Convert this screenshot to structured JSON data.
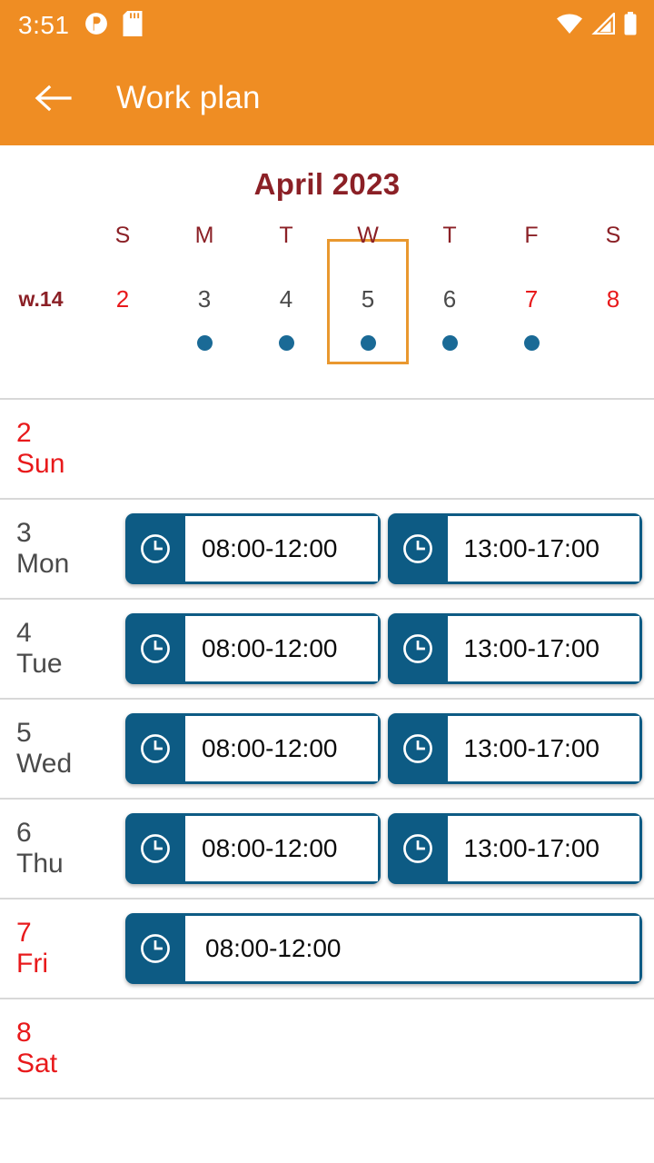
{
  "status_bar": {
    "time": "3:51",
    "icons": [
      "p-badge-icon",
      "sd-card-icon",
      "wifi-icon",
      "cellular-signal-icon",
      "battery-icon"
    ]
  },
  "app_bar": {
    "back_label": "back-arrow-icon",
    "title": "Work plan"
  },
  "calendar": {
    "month_title": "April 2023",
    "week_label": "w.14",
    "weekday_letters": [
      "S",
      "M",
      "T",
      "W",
      "T",
      "F",
      "S"
    ],
    "days": [
      {
        "date": "2",
        "weekend": true,
        "dot": false
      },
      {
        "date": "3",
        "weekend": false,
        "dot": true
      },
      {
        "date": "4",
        "weekend": false,
        "dot": true
      },
      {
        "date": "5",
        "weekend": false,
        "dot": true,
        "today": true
      },
      {
        "date": "6",
        "weekend": false,
        "dot": true
      },
      {
        "date": "7",
        "weekend": true,
        "dot": true
      },
      {
        "date": "8",
        "weekend": true,
        "dot": false
      }
    ]
  },
  "colors": {
    "accent_orange": "#ef8d23",
    "title_maroon": "#8b2026",
    "weekend_red": "#e8191b",
    "chip_blue": "#0d5b84",
    "dot_blue": "#1a6a96",
    "divider_gray": "#d8d8d8",
    "weekday_gray": "#4a4a4a"
  },
  "schedule": [
    {
      "day_num": "2",
      "day_name": "Sun",
      "weekend": true,
      "slots": []
    },
    {
      "day_num": "3",
      "day_name": "Mon",
      "weekend": false,
      "slots": [
        "08:00-12:00",
        "13:00-17:00"
      ]
    },
    {
      "day_num": "4",
      "day_name": "Tue",
      "weekend": false,
      "slots": [
        "08:00-12:00",
        "13:00-17:00"
      ]
    },
    {
      "day_num": "5",
      "day_name": "Wed",
      "weekend": false,
      "slots": [
        "08:00-12:00",
        "13:00-17:00"
      ]
    },
    {
      "day_num": "6",
      "day_name": "Thu",
      "weekend": false,
      "slots": [
        "08:00-12:00",
        "13:00-17:00"
      ]
    },
    {
      "day_num": "7",
      "day_name": "Fri",
      "weekend": true,
      "slots": [
        "08:00-12:00"
      ]
    },
    {
      "day_num": "8",
      "day_name": "Sat",
      "weekend": true,
      "slots": []
    }
  ]
}
